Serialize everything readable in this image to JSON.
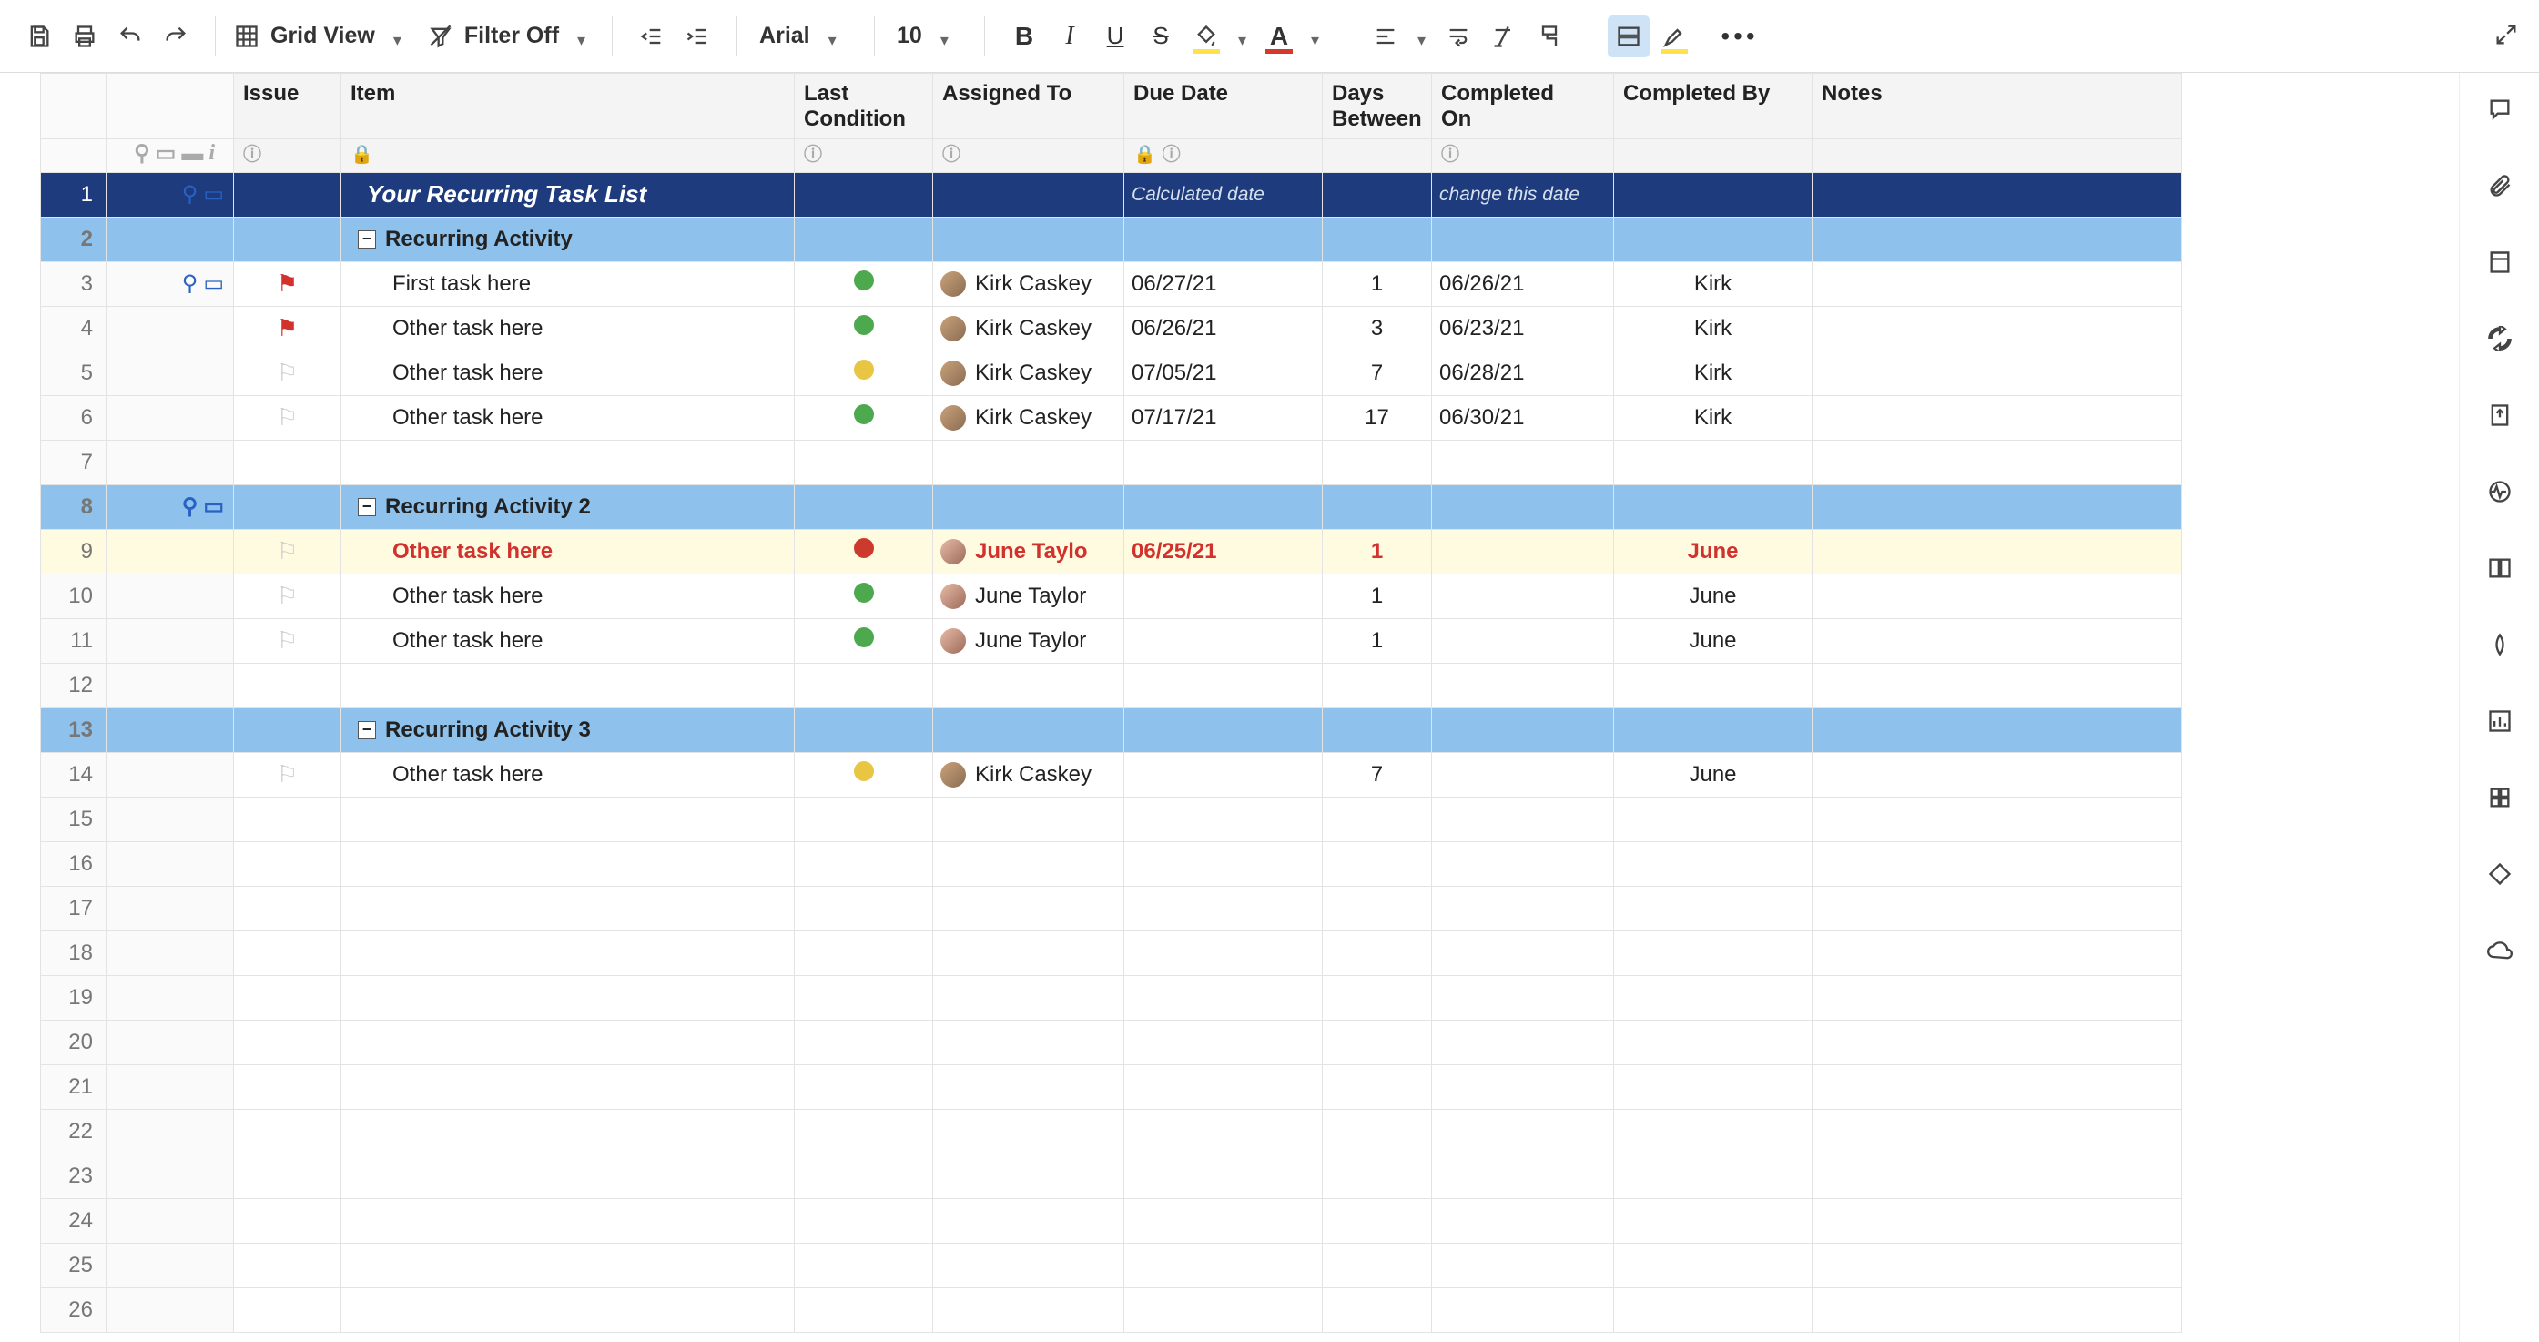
{
  "toolbar": {
    "view_label": "Grid View",
    "filter_label": "Filter Off",
    "font_family": "Arial",
    "font_size": "10"
  },
  "columns": {
    "issue": "Issue",
    "item": "Item",
    "last_condition_1": "Last",
    "last_condition_2": "Condition",
    "assigned_to": "Assigned To",
    "due_date": "Due Date",
    "days_between_1": "Days",
    "days_between_2": "Between",
    "completed_on_1": "Completed",
    "completed_on_2": "On",
    "completed_by": "Completed By",
    "notes": "Notes"
  },
  "title_row": {
    "item": "Your Recurring Task List",
    "due_hint": "Calculated date",
    "completed_hint": "change this date"
  },
  "groups": [
    {
      "label": "Recurring Activity"
    },
    {
      "label": "Recurring Activity 2"
    },
    {
      "label": "Recurring Activity 3"
    }
  ],
  "rows": [
    {
      "num": 3,
      "flag": "red",
      "item": "First task here",
      "status": "green",
      "assigned": "Kirk Caskey",
      "avatar": "m",
      "due": "06/27/21",
      "days": "1",
      "completed": "06/26/21",
      "by": "Kirk",
      "at": true,
      "cm": true
    },
    {
      "num": 4,
      "flag": "red",
      "item": "Other task here",
      "status": "green",
      "assigned": "Kirk Caskey",
      "avatar": "m",
      "due": "06/26/21",
      "days": "3",
      "completed": "06/23/21",
      "by": "Kirk"
    },
    {
      "num": 5,
      "flag": "off",
      "item": "Other task here",
      "status": "yellow",
      "assigned": "Kirk Caskey",
      "avatar": "m",
      "due": "07/05/21",
      "days": "7",
      "completed": "06/28/21",
      "by": "Kirk"
    },
    {
      "num": 6,
      "flag": "off",
      "item": "Other task here",
      "status": "green",
      "assigned": "Kirk Caskey",
      "avatar": "m",
      "due": "07/17/21",
      "days": "17",
      "completed": "06/30/21",
      "by": "Kirk"
    },
    {
      "num": 9,
      "flag": "off",
      "item": "Other task here",
      "status": "red",
      "assigned": "June Taylo",
      "avatar": "f",
      "due": "06/25/21",
      "days": "1",
      "completed": "",
      "by": "June",
      "highlight": true
    },
    {
      "num": 10,
      "flag": "off",
      "item": "Other task here",
      "status": "green",
      "assigned": "June Taylor",
      "avatar": "f",
      "due": "",
      "days": "1",
      "completed": "",
      "by": "June"
    },
    {
      "num": 11,
      "flag": "off",
      "item": "Other task here",
      "status": "green",
      "assigned": "June Taylor",
      "avatar": "f",
      "due": "",
      "days": "1",
      "completed": "",
      "by": "June"
    },
    {
      "num": 14,
      "flag": "off",
      "item": "Other task here",
      "status": "yellow",
      "assigned": "Kirk Caskey",
      "avatar": "m",
      "due": "",
      "days": "7",
      "completed": "",
      "by": "June"
    }
  ],
  "row_numbers": [
    "1",
    "2",
    "3",
    "4",
    "5",
    "6",
    "7",
    "8",
    "9",
    "10",
    "11",
    "12",
    "13",
    "14",
    "15",
    "16",
    "17",
    "18",
    "19",
    "20",
    "21",
    "22",
    "23",
    "24",
    "25",
    "26"
  ]
}
